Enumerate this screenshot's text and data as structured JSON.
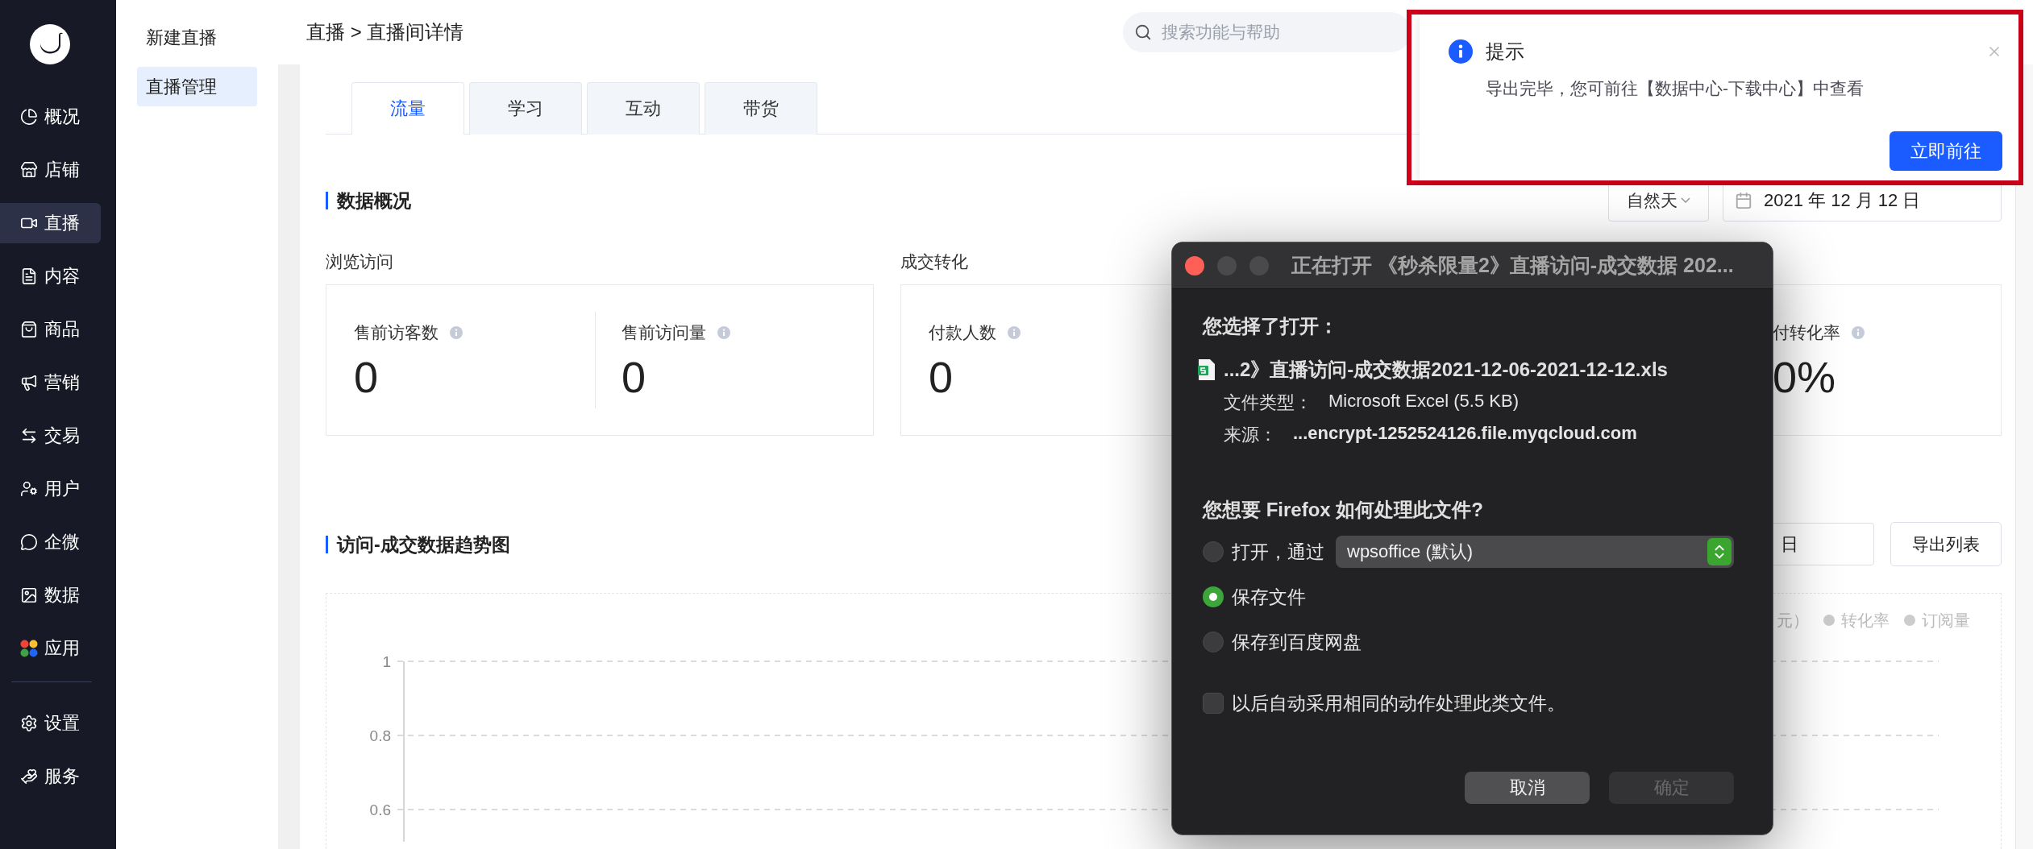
{
  "sidebar": {
    "nav": [
      {
        "label": "概况",
        "selected": false
      },
      {
        "label": "店铺",
        "selected": false
      },
      {
        "label": "直播",
        "selected": true
      },
      {
        "label": "内容",
        "selected": false
      },
      {
        "label": "商品",
        "selected": false
      },
      {
        "label": "营销",
        "selected": false
      },
      {
        "label": "交易",
        "selected": false
      },
      {
        "label": "用户",
        "selected": false
      },
      {
        "label": "企微",
        "selected": false
      },
      {
        "label": "数据",
        "selected": false
      },
      {
        "label": "应用",
        "selected": false
      }
    ],
    "bottom_nav": [
      {
        "label": "设置",
        "selected": false
      },
      {
        "label": "服务",
        "selected": false
      }
    ]
  },
  "submenu": [
    {
      "label": "新建直播",
      "selected": false
    },
    {
      "label": "直播管理",
      "selected": true
    }
  ],
  "header": {
    "breadcrumb": "直播 > 直播间详情",
    "search": {
      "placeholder": "搜索功能与帮助"
    }
  },
  "tabs": [
    {
      "label": "流量",
      "selected": true
    },
    {
      "label": "学习",
      "selected": false
    },
    {
      "label": "互动",
      "selected": false
    },
    {
      "label": "带货",
      "selected": false
    }
  ],
  "overview": {
    "title": "数据概况",
    "period": "自然天",
    "date": "2021 年 12 月 12 日",
    "groups": [
      {
        "title": "浏览访问",
        "metrics": [
          {
            "label": "售前访客数",
            "value": "0"
          },
          {
            "label": "售前访问量",
            "value": "0"
          }
        ]
      },
      {
        "title": "成交转化",
        "metrics": [
          {
            "label": "付款人数",
            "value": "0"
          },
          {
            "label": "付转化率",
            "value": "0%"
          }
        ]
      }
    ]
  },
  "trend": {
    "title": "访问-成交数据趋势图",
    "date_field": "日",
    "export_button": "导出列表",
    "legend_cut": "元）",
    "legend": [
      "转化率",
      "订阅量"
    ],
    "y_axis_labels": [
      "1",
      "0.8",
      "0.6"
    ]
  },
  "notification": {
    "title": "提示",
    "message": "导出完毕，您可前往【数据中心-下载中心】中查看",
    "action": "立即前往",
    "highlighted": true
  },
  "dialog": {
    "title": "正在打开 《秒杀限量2》直播访问-成交数据 202...",
    "heading": "您选择了打开：",
    "file_name": "...2》直播访问-成交数据2021-12-06-2021-12-12.xls",
    "details": [
      {
        "label": "文件类型：",
        "value": "Microsoft Excel (5.5 KB)",
        "emphasis": false
      },
      {
        "label": "来源：",
        "value": "...encrypt-1252524126.file.myqcloud.com",
        "emphasis": true
      }
    ],
    "question": "您想要 Firefox 如何处理此文件?",
    "options": [
      {
        "kind": "app",
        "label": "打开，通过",
        "app": "wpsoffice (默认)",
        "selected": false
      },
      {
        "kind": "plain",
        "label": "保存文件",
        "selected": true
      },
      {
        "kind": "plain",
        "label": "保存到百度网盘",
        "selected": false
      }
    ],
    "remember": {
      "label": "以后自动采用相同的动作处理此类文件。",
      "checked": false
    },
    "buttons": [
      {
        "label": "取消",
        "disabled": false
      },
      {
        "label": "确定",
        "disabled": true
      }
    ]
  }
}
